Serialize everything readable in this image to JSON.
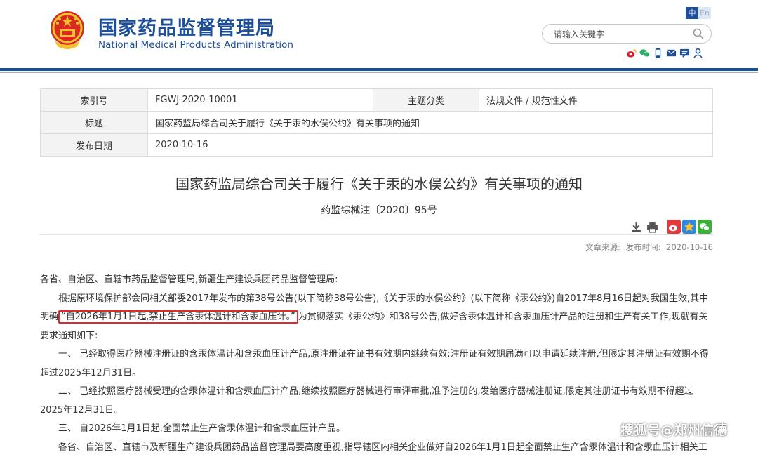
{
  "header": {
    "org_name_cn": "国家药品监督管理局",
    "org_name_en": "National Medical Products Administration",
    "lang_zh": "中",
    "lang_en": "En",
    "search_placeholder": "请输入关键字"
  },
  "meta": {
    "index_label": "索引号",
    "index_value": "FGWJ-2020-10001",
    "category_label": "主题分类",
    "category_value": "法规文件 / 规范性文件",
    "title_label": "标题",
    "title_value": "国家药监局综合司关于履行《关于汞的水俣公约》有关事项的通知",
    "date_label": "发布日期",
    "date_value": "2020-10-16"
  },
  "article": {
    "title": "国家药监局综合司关于履行《关于汞的水俣公约》有关事项的通知",
    "doc_no": "药监综械注〔2020〕95号",
    "source_label": "文章来源:",
    "publish_label": "发布时间:",
    "publish_date": "2020-10-16",
    "salutation": "各省、自治区、直辖市药品监督管理局,新疆生产建设兵团药品监督管理局:",
    "p1_before": "根据原环境保护部会同相关部委2017年发布的第38号公告(以下简称38号公告),《关于汞的水俣公约》(以下简称《汞公约》)自2017年8月16日起对我国生效,其中明确",
    "p1_highlight": "“自2026年1月1日起,禁止生产含汞体温计和含汞血压计。”",
    "p1_after": "为贯彻落实《汞公约》和38号公告,做好含汞体温计和含汞血压计产品的注册和生产有关工作,现就有关要求通知如下:",
    "p2": "一、 已经取得医疗器械注册证的含汞体温计和含汞血压计产品,原注册证在证书有效期内继续有效;注册证有效期届满可以申请延续注册,但限定其注册证有效期不得超过2025年12月31日。",
    "p3": "二、 已经按照医疗器械受理的含汞体温计和含汞血压计产品,继续按照医疗器械进行审评审批,准予注册的,发给医疗器械注册证,限定其注册证书有效期不得超过2025年12月31日。",
    "p4": "三、 自2026年1月1日起,全面禁止生产含汞体温计和含汞血压计产品。",
    "p5": "各省、自治区、直辖市及新疆生产建设兵团药品监督管理局要高度重视,指导辖区内相关企业做好自2026年1月1日起全面禁止生产含汞体温计和含汞血压计相关工"
  },
  "watermark": "搜狐号@郑州信德",
  "colors": {
    "brand_blue": "#1d4e9c",
    "highlight_red": "#e5262a"
  }
}
